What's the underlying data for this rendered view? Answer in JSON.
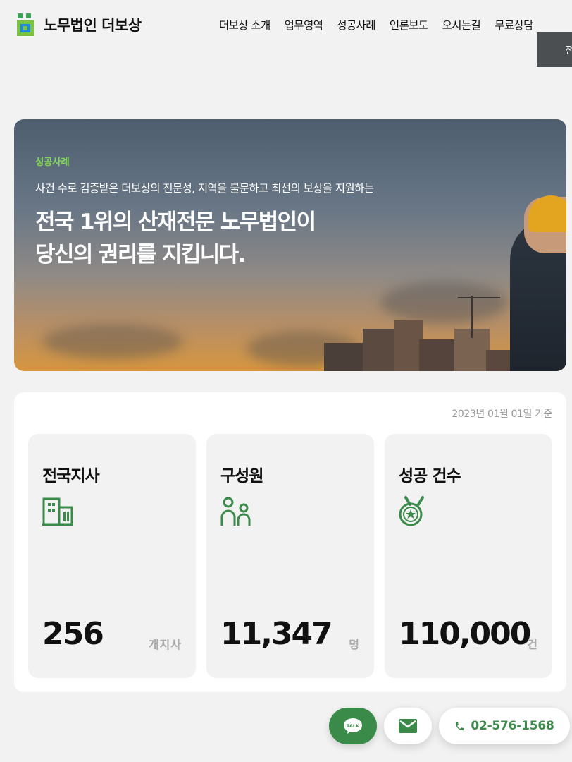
{
  "header": {
    "logo_text": "노무법인 더보상",
    "nav": [
      "더보상 소개",
      "업무영역",
      "성공사례",
      "언론보도",
      "오시는길",
      "무료상담"
    ],
    "sub_button": "전"
  },
  "hero": {
    "label": "성공사례",
    "subtitle": "사건 수로 검증받은 더보상의 전문성, 지역을 불문하고 최선의 보상을 지원하는",
    "title_line1": "전국 1위의 산재전문 노무법인이",
    "title_line2": "당신의 권리를 지킵니다."
  },
  "stats": {
    "date": "2023년 01월 01일 기준",
    "cards": [
      {
        "title": "전국지사",
        "icon": "building-icon",
        "value": "256",
        "unit": "개지사"
      },
      {
        "title": "구성원",
        "icon": "people-icon",
        "value": "11,347",
        "unit": "명"
      },
      {
        "title": "성공 건수",
        "icon": "medal-icon",
        "value": "110,000",
        "unit": "건"
      }
    ]
  },
  "floating": {
    "talk_label": "TALK",
    "mail_icon": "mail-icon",
    "phone_number": "02-576-1568"
  },
  "colors": {
    "brand_green": "#3a8a4a",
    "accent_label": "#7fd35a",
    "dark_button": "#4b4f52"
  }
}
